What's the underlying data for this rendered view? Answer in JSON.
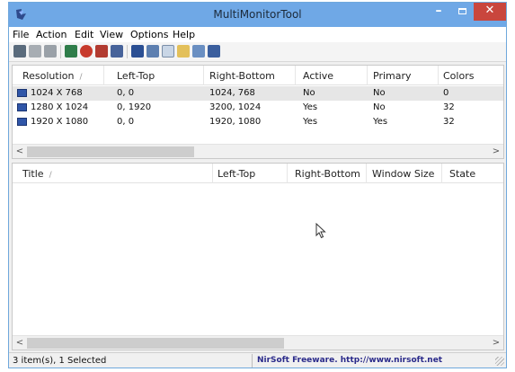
{
  "window": {
    "title": "MultiMonitorTool"
  },
  "menu": [
    "File",
    "Action",
    "Edit",
    "View",
    "Options",
    "Help"
  ],
  "toolbar": {
    "icons": [
      "disable-monitor-icon",
      "enable-monitor-icon",
      "switch-monitor-icon",
      "move-windows-icon",
      "set-primary-icon",
      "turn-off-icon",
      "turn-on-icon",
      "save-config-icon",
      "load-config-icon",
      "copy-icon",
      "properties-icon",
      "html-report-icon",
      "exit-icon"
    ]
  },
  "monitors": {
    "headers": [
      "Resolution",
      "Left-Top",
      "Right-Bottom",
      "Active",
      "Primary",
      "Colors"
    ],
    "sort_indicator": "/",
    "rows": [
      {
        "resolution": "1024 X 768",
        "left_top": "0, 0",
        "right_bottom": "1024, 768",
        "active": "No",
        "primary": "No",
        "colors": "0"
      },
      {
        "resolution": "1280 X 1024",
        "left_top": "0, 1920",
        "right_bottom": "3200, 1024",
        "active": "Yes",
        "primary": "No",
        "colors": "32"
      },
      {
        "resolution": "1920 X 1080",
        "left_top": "0, 0",
        "right_bottom": "1920, 1080",
        "active": "Yes",
        "primary": "Yes",
        "colors": "32"
      }
    ]
  },
  "windows": {
    "headers": [
      "Title",
      "Left-Top",
      "Right-Bottom",
      "Window Size",
      "State"
    ],
    "sort_indicator": "/"
  },
  "scroll": {
    "left_arrow": "<",
    "right_arrow": ">"
  },
  "status": {
    "items": "3 item(s), 1 Selected",
    "credit": "NirSoft Freeware.  http://www.nirsoft.net"
  },
  "colors": {
    "titlebar": "#6fa8e6",
    "close_button": "#c9463d",
    "selected_row": "#e6e6e6",
    "monitor_icon": "#3056a8",
    "credit_text": "#2a2a8a"
  }
}
